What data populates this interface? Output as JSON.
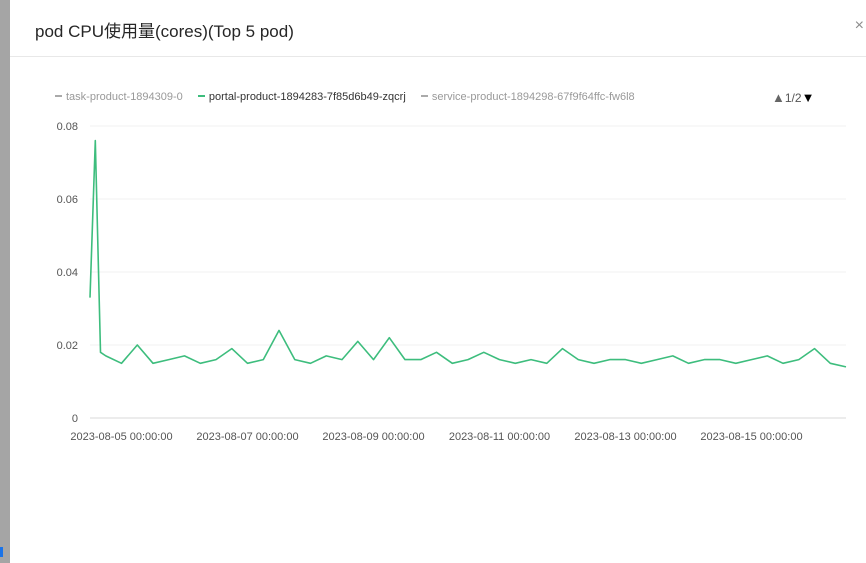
{
  "dialog": {
    "title": "pod CPU使用量(cores)(Top 5 pod)",
    "close_glyph": "×"
  },
  "legend": {
    "items": [
      {
        "label": "task-product-1894309-0",
        "color": "#aaaaaa",
        "active": false
      },
      {
        "label": "portal-product-1894283-7f85d6b49-zqcrj",
        "color": "#3dbd7d",
        "active": true
      },
      {
        "label": "service-product-1894298-67f9f64ffc-fw6l8",
        "color": "#aaaaaa",
        "active": false
      }
    ],
    "page_text": "1/2"
  },
  "chart_data": {
    "type": "line",
    "title": "pod CPU使用量(cores)(Top 5 pod)",
    "xlabel": "",
    "ylabel": "",
    "ylim": [
      0,
      0.08
    ],
    "yticks": [
      "0.08",
      "0.06",
      "0.04",
      "0.02",
      "0"
    ],
    "xlim": [
      "2023-08-04 12:00:00",
      "2023-08-16 12:00:00"
    ],
    "xticks": [
      "2023-08-05 00:00:00",
      "2023-08-07 00:00:00",
      "2023-08-09 00:00:00",
      "2023-08-11 00:00:00",
      "2023-08-13 00:00:00",
      "2023-08-15 00:00:00"
    ],
    "grid": true,
    "legend_position": "top-left",
    "series": [
      {
        "name": "portal-product-1894283-7f85d6b49-zqcrj",
        "color": "#3dbd7d",
        "x": [
          "2023-08-04 12:00:00",
          "2023-08-04 14:00:00",
          "2023-08-04 16:00:00",
          "2023-08-04 18:00:00",
          "2023-08-05 00:00:00",
          "2023-08-05 06:00:00",
          "2023-08-05 12:00:00",
          "2023-08-05 18:00:00",
          "2023-08-06 00:00:00",
          "2023-08-06 06:00:00",
          "2023-08-06 12:00:00",
          "2023-08-06 18:00:00",
          "2023-08-07 00:00:00",
          "2023-08-07 06:00:00",
          "2023-08-07 12:00:00",
          "2023-08-07 18:00:00",
          "2023-08-08 00:00:00",
          "2023-08-08 06:00:00",
          "2023-08-08 12:00:00",
          "2023-08-08 18:00:00",
          "2023-08-09 00:00:00",
          "2023-08-09 06:00:00",
          "2023-08-09 12:00:00",
          "2023-08-09 18:00:00",
          "2023-08-10 00:00:00",
          "2023-08-10 06:00:00",
          "2023-08-10 12:00:00",
          "2023-08-10 18:00:00",
          "2023-08-11 00:00:00",
          "2023-08-11 06:00:00",
          "2023-08-11 12:00:00",
          "2023-08-11 18:00:00",
          "2023-08-12 00:00:00",
          "2023-08-12 06:00:00",
          "2023-08-12 12:00:00",
          "2023-08-12 18:00:00",
          "2023-08-13 00:00:00",
          "2023-08-13 06:00:00",
          "2023-08-13 12:00:00",
          "2023-08-13 18:00:00",
          "2023-08-14 00:00:00",
          "2023-08-14 06:00:00",
          "2023-08-14 12:00:00",
          "2023-08-14 18:00:00",
          "2023-08-15 00:00:00",
          "2023-08-15 06:00:00",
          "2023-08-15 12:00:00",
          "2023-08-15 18:00:00",
          "2023-08-16 00:00:00",
          "2023-08-16 06:00:00",
          "2023-08-16 12:00:00"
        ],
        "values": [
          0.033,
          0.076,
          0.018,
          0.017,
          0.015,
          0.02,
          0.015,
          0.016,
          0.017,
          0.015,
          0.016,
          0.019,
          0.015,
          0.016,
          0.024,
          0.016,
          0.015,
          0.017,
          0.016,
          0.021,
          0.016,
          0.022,
          0.016,
          0.016,
          0.018,
          0.015,
          0.016,
          0.018,
          0.016,
          0.015,
          0.016,
          0.015,
          0.019,
          0.016,
          0.015,
          0.016,
          0.016,
          0.015,
          0.016,
          0.017,
          0.015,
          0.016,
          0.016,
          0.015,
          0.016,
          0.017,
          0.015,
          0.016,
          0.019,
          0.015,
          0.014
        ]
      }
    ]
  }
}
